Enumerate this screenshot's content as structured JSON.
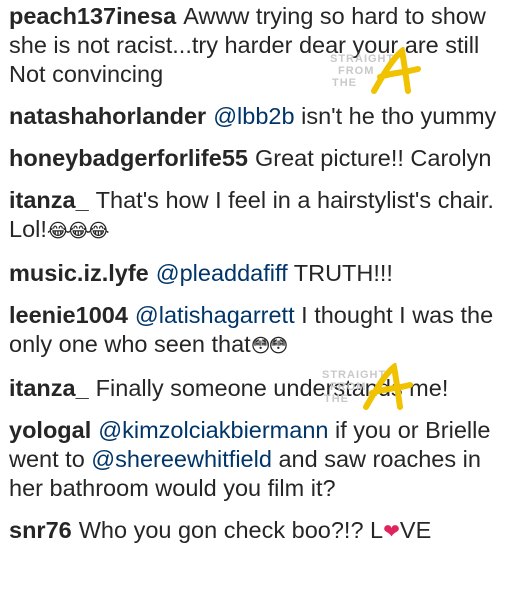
{
  "comments": [
    {
      "username": "peach137inesa",
      "segments": [
        {
          "type": "text",
          "value": "Awww trying so hard to show she is not racist...try harder dear your are still Not convincing"
        }
      ]
    },
    {
      "username": "natashahorlander",
      "segments": [
        {
          "type": "mention",
          "value": "@lbb2b"
        },
        {
          "type": "text",
          "value": " isn't he tho yummy"
        }
      ]
    },
    {
      "username": "honeybadgerforlife55",
      "segments": [
        {
          "type": "text",
          "value": "Great picture!! Carolyn"
        }
      ]
    },
    {
      "username": "itanza_",
      "segments": [
        {
          "type": "text",
          "value": "That's how I feel in a hairstylist's chair. Lol!"
        },
        {
          "type": "emoji",
          "value": "😂😂😂"
        }
      ]
    },
    {
      "username": "music.iz.lyfe",
      "segments": [
        {
          "type": "mention",
          "value": "@pleaddafiff"
        },
        {
          "type": "text",
          "value": " TRUTH!!!"
        }
      ]
    },
    {
      "username": "leenie1004",
      "segments": [
        {
          "type": "mention",
          "value": "@latishagarrett"
        },
        {
          "type": "text",
          "value": " I thought I was the only one who seen that"
        },
        {
          "type": "emoji",
          "value": "😳😳"
        }
      ]
    },
    {
      "username": "itanza_",
      "segments": [
        {
          "type": "text",
          "value": "Finally someone understands me!"
        }
      ]
    },
    {
      "username": "yologal",
      "segments": [
        {
          "type": "mention",
          "value": "@kimzolciakbiermann"
        },
        {
          "type": "text",
          "value": " if you or Brielle went to "
        },
        {
          "type": "mention",
          "value": "@shereewhitfield"
        },
        {
          "type": "text",
          "value": " and saw roaches in her bathroom would you film it?"
        }
      ]
    },
    {
      "username": "snr76",
      "segments": [
        {
          "type": "text",
          "value": "Who you gon check boo?!? L"
        },
        {
          "type": "heart",
          "value": "❤"
        },
        {
          "type": "text",
          "value": "VE"
        }
      ]
    }
  ],
  "watermark": {
    "line1": "STRAIGHT",
    "line2": "FROM",
    "line3": "THE",
    "letter": "A",
    "letter_color": "#f0c200"
  }
}
